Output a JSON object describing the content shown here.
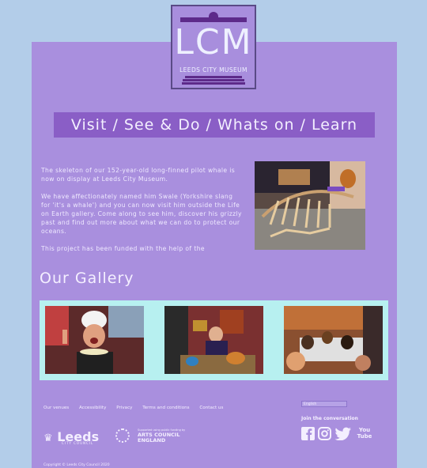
{
  "logo": {
    "letters": "LCM",
    "subtitle": "LEEDS CITY MUSEUM"
  },
  "nav": {
    "items": [
      "Visit",
      "See & Do",
      "Whats on",
      "Learn"
    ],
    "separator": " / "
  },
  "intro": {
    "paragraphs": [
      "The skeleton of our 152-year-old long-finned pilot whale is now on display at Leeds City Museum.",
      "We have affectionately named him Swale (Yorkshire slang for 'it's a whale') and you can now visit him outside the Life on Earth gallery. Come along to see him, discover his grizzly past and find out more about what we can do to protect our oceans.",
      "This project has been funded with the help of the"
    ]
  },
  "gallery": {
    "title": "Our Gallery"
  },
  "footer": {
    "links": [
      "Our venues",
      "Accessibility",
      "Privacy",
      "Terms and conditions",
      "Contact us"
    ],
    "language": "English",
    "convo": "Join the conversation",
    "social": [
      "facebook-icon",
      "instagram-icon",
      "twitter-icon",
      "youtube-icon"
    ],
    "youtube_label": "You Tube",
    "leeds_logo": "Leeds",
    "leeds_sub": "CITY COUNCIL",
    "arts_small": "Supported using public funding by",
    "arts_line1": "ARTS COUNCIL",
    "arts_line2": "ENGLAND",
    "copyright": "Copyright © Leeds City Council 2020"
  },
  "colors": {
    "background": "#b3cde9",
    "panel": "#a98fde",
    "nav_bar": "#8a5ec6",
    "gallery_strip": "#b7f0f0",
    "logo_accent": "#5d2a8a"
  }
}
